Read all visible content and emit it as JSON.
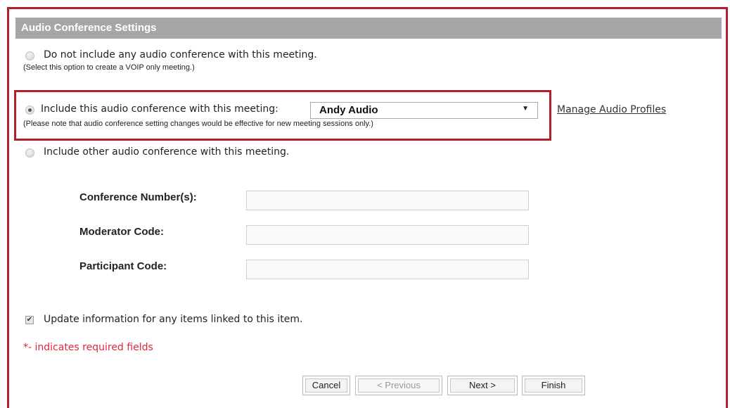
{
  "section": {
    "title": "Audio Conference Settings"
  },
  "options": {
    "no_audio": {
      "label": "Do not include any audio conference with this meeting.",
      "hint": "(Select this option to create a VOIP only meeting.)",
      "selected": false
    },
    "include_profile": {
      "label": "Include this audio conference with this meeting:",
      "hint": "(Please note that audio conference setting changes would be effective for new meeting sessions only.)",
      "selected": true,
      "profile_select": {
        "value": "Andy Audio"
      },
      "manage_link": "Manage Audio Profiles"
    },
    "include_other": {
      "label": "Include other audio conference with this meeting.",
      "selected": false
    }
  },
  "fields": {
    "conference_number": {
      "label": "Conference Number(s):",
      "value": ""
    },
    "moderator_code": {
      "label": "Moderator Code:",
      "value": ""
    },
    "participant_code": {
      "label": "Participant Code:",
      "value": ""
    }
  },
  "update_linked": {
    "label": "Update information for any items linked to this item.",
    "checked": true
  },
  "required_note": "*- indicates required fields",
  "buttons": {
    "cancel": "Cancel",
    "previous": "< Previous",
    "next": "Next >",
    "finish": "Finish"
  },
  "colors": {
    "highlight": "#b0202c",
    "header": "#a6a6a6",
    "required": "#e0283a"
  }
}
